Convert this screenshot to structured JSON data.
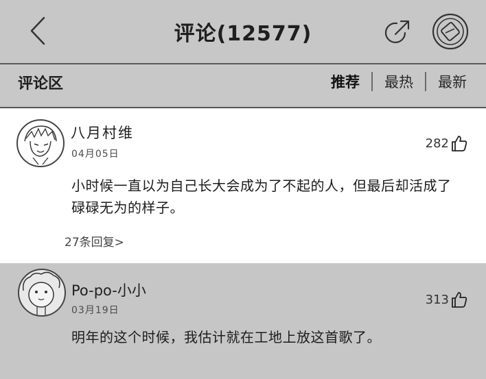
{
  "header": {
    "title": "评论(12577)",
    "back_icon": "chevron-left-icon",
    "share_icon": "share-icon",
    "emblem_icon": "badge-icon"
  },
  "subbar": {
    "section_label": "评论区",
    "sort_tabs": [
      "推荐",
      "最热",
      "最新"
    ],
    "active_sort": "推荐"
  },
  "comments": [
    {
      "username": "八月村维",
      "date": "04月05日",
      "likes": "282",
      "text": "小时候一直以为自己长大会成为了不起的人，但最后却活成了碌碌无为的样子。",
      "replies": "27条回复>"
    },
    {
      "username": "Po-po-小小",
      "date": "03月19日",
      "likes": "313",
      "text": "明年的这个时候，我估计就在工地上放这首歌了。"
    }
  ],
  "colors": {
    "background": "#c6c6c6",
    "highlight_card": "#ffffff",
    "text": "#1f1f1f"
  }
}
